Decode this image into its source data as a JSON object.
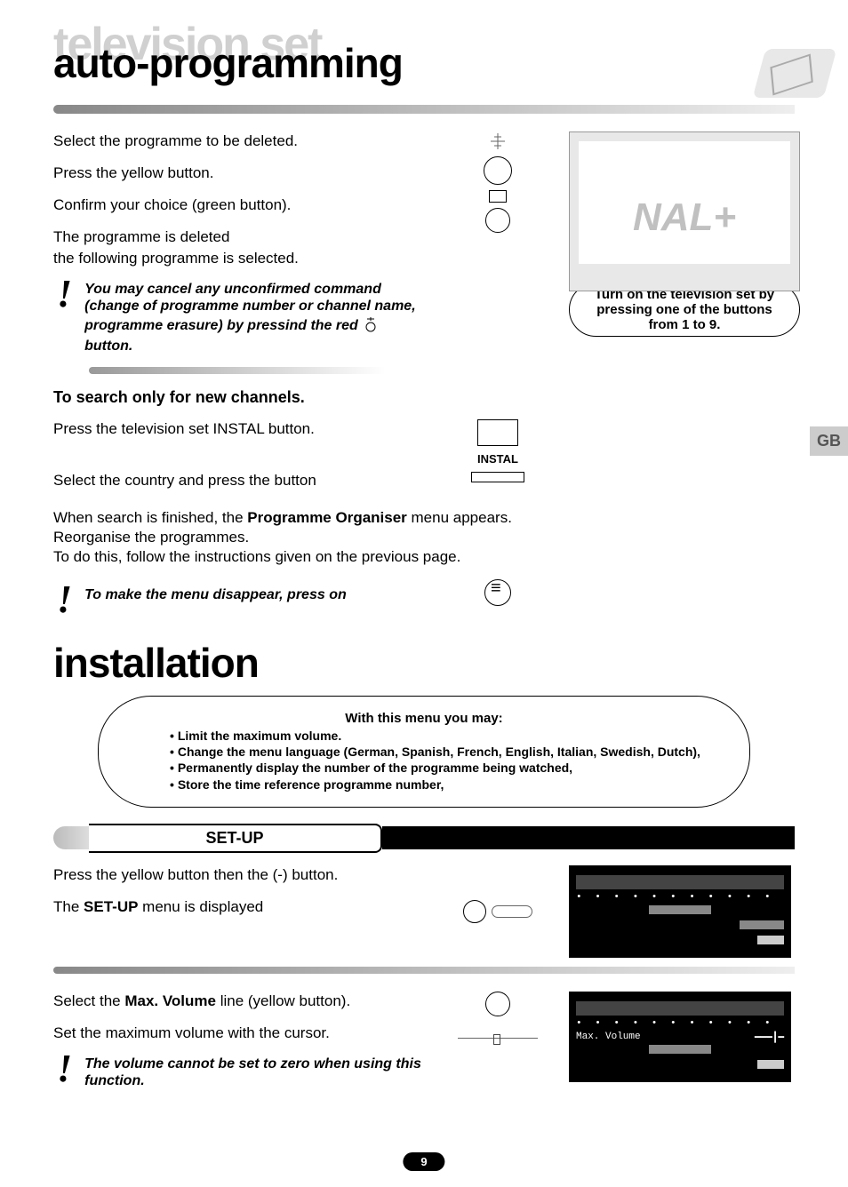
{
  "header": {
    "ghost_title": "television set",
    "main_title": "auto-programming"
  },
  "delete_section": {
    "p1": "Select the programme to be deleted.",
    "p2": "Press the yellow button.",
    "p3": "Confirm your choice (green button).",
    "p4a": "The programme is deleted",
    "p4b": "the following programme is selected.",
    "note": "You may cancel any unconfirmed command (change of programme number or channel name, programme erasure) by pressind the red",
    "note_suffix": "button."
  },
  "tv_callout": "Turn on the television set by pressing one of the buttons from 1 to 9.",
  "tv_brand": "NAL+",
  "search_section": {
    "heading": "To search only for new channels.",
    "p1": "Press the television set INSTAL button.",
    "instal_label": "INSTAL",
    "p2": "Select the country and press the button",
    "p3": "When search is finished, the Programme Organiser menu appears. Reorganise the programmes. To do this, follow the instructions given on the previous page.",
    "note": "To make the menu disappear, press on"
  },
  "install_title": "installation",
  "menu_desc": {
    "lead": "With this menu you may:",
    "items": [
      "Limit the maximum volume.",
      "Change the menu language (German, Spanish, French, English, Italian, Swedish, Dutch),",
      "Permanently display  the number of the programme being watched,",
      "Store the time reference programme number,"
    ]
  },
  "setup_banner": "SET-UP",
  "setup_section": {
    "p1": "Press the yellow button then the (-) button.",
    "p2": "The SET-UP menu is displayed"
  },
  "maxvol_section": {
    "p1": "Select the Max. Volume line (yellow button).",
    "p2": "Set the maximum volume with the cursor.",
    "note": "The volume cannot be set to zero when using this function."
  },
  "osd_maxvol_label": "Max. Volume",
  "side_tab": "GB",
  "page_number": "9"
}
